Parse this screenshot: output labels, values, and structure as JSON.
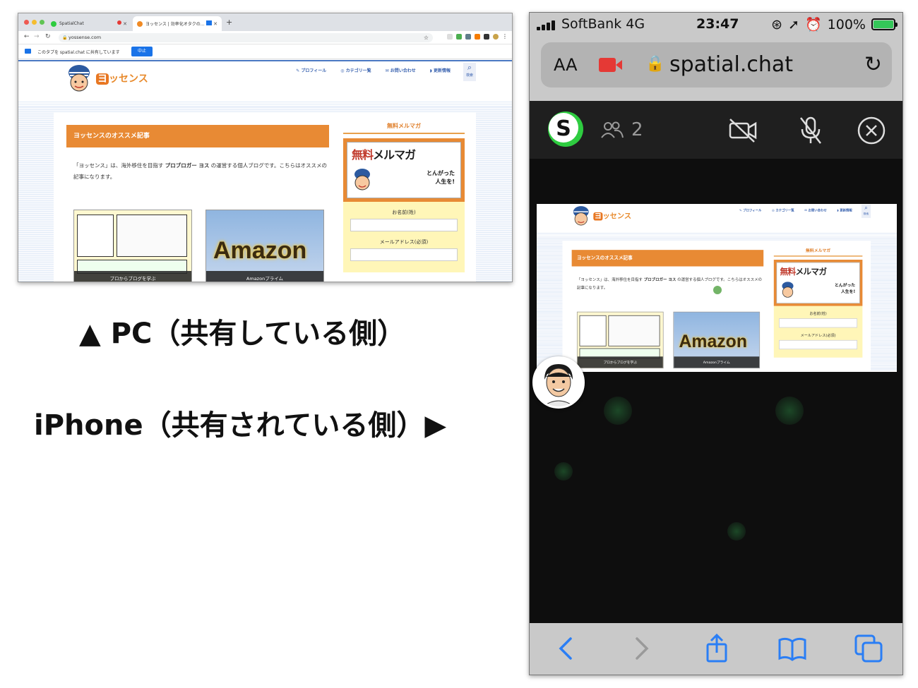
{
  "pc": {
    "tabs": [
      {
        "title": "SpatialChat"
      },
      {
        "title": "ヨッセンス | 効率化オタクの…"
      }
    ],
    "new_tab": "+",
    "url": "yossense.com",
    "share_notice": "このタブを spatial.chat に共有しています",
    "stop_label": "中止"
  },
  "site": {
    "logo": "ヨッセンス",
    "logo_badge": "ヨ",
    "logo_rest": "ッセンス",
    "nav": [
      {
        "label": "プロフィール",
        "icon": "pen-icon"
      },
      {
        "label": "カテゴリ一覧",
        "icon": "compass-icon"
      },
      {
        "label": "お問い合わせ",
        "icon": "mail-icon"
      },
      {
        "label": "更新情報",
        "icon": "rss-icon"
      }
    ],
    "search_label": "検索",
    "section_title": "ヨッセンスのオススメ記事",
    "intro_pre": "「ヨッセンス」は、海外移住を目指す",
    "intro_bold": "プロブロガー ヨス",
    "intro_post": "の運営する個人ブログです。こちらはオススメの記事になります。",
    "thumbs": [
      {
        "caption": "プロからブログを学ぶ"
      },
      {
        "caption": "Amazonプライム",
        "image_text": "Amazon"
      }
    ],
    "sidebar": {
      "title": "無料メルマガ",
      "banner_red": "無料",
      "banner_black": "メルマガ",
      "banner_sub1": "とんがった",
      "banner_sub2": "人生を!",
      "label_name": "お名前(姓)",
      "label_email": "メールアドレス(必須)"
    }
  },
  "captions": {
    "pc": "▲ PC（共有している側）",
    "iphone": "iPhone（共有されている側）▶"
  },
  "iphone": {
    "carrier": "SoftBank  4G",
    "time": "23:47",
    "battery": "100%",
    "aa_label": "AA",
    "host": "spatial.chat",
    "participants": "2",
    "colors": {
      "accent_green": "#2ecc40",
      "record_red": "#e53935",
      "battery_green": "#34c759"
    }
  }
}
